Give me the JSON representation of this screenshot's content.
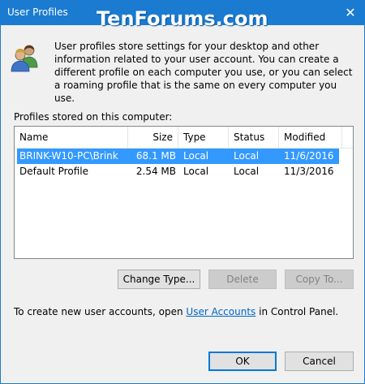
{
  "window": {
    "title": "User Profiles",
    "watermark": "TenForums.com",
    "close_glyph": "✕"
  },
  "intro": {
    "text": "User profiles store settings for your desktop and other information related to your user account. You can create a different profile on each computer you use, or you can select a roaming profile that is the same on every computer you use."
  },
  "profiles": {
    "label": "Profiles stored on this computer:",
    "columns": [
      "Name",
      "Size",
      "Type",
      "Status",
      "Modified"
    ],
    "rows": [
      {
        "name": "BRINK-W10-PC\\Brink",
        "size": "68.1 MB",
        "type": "Local",
        "status": "Local",
        "modified": "11/6/2016",
        "selected": true
      },
      {
        "name": "Default Profile",
        "size": "2.54 MB",
        "type": "Local",
        "status": "Local",
        "modified": "11/3/2016",
        "selected": false
      }
    ]
  },
  "buttons": {
    "change_type": "Change Type...",
    "delete": "Delete",
    "copy_to": "Copy To...",
    "ok": "OK",
    "cancel": "Cancel"
  },
  "footer": {
    "prefix": "To create new user accounts, open ",
    "link": "User Accounts",
    "suffix": " in Control Panel."
  },
  "colors": {
    "titlebar": "#1a7bd1",
    "selection": "#3399ff",
    "link": "#0066cc"
  }
}
